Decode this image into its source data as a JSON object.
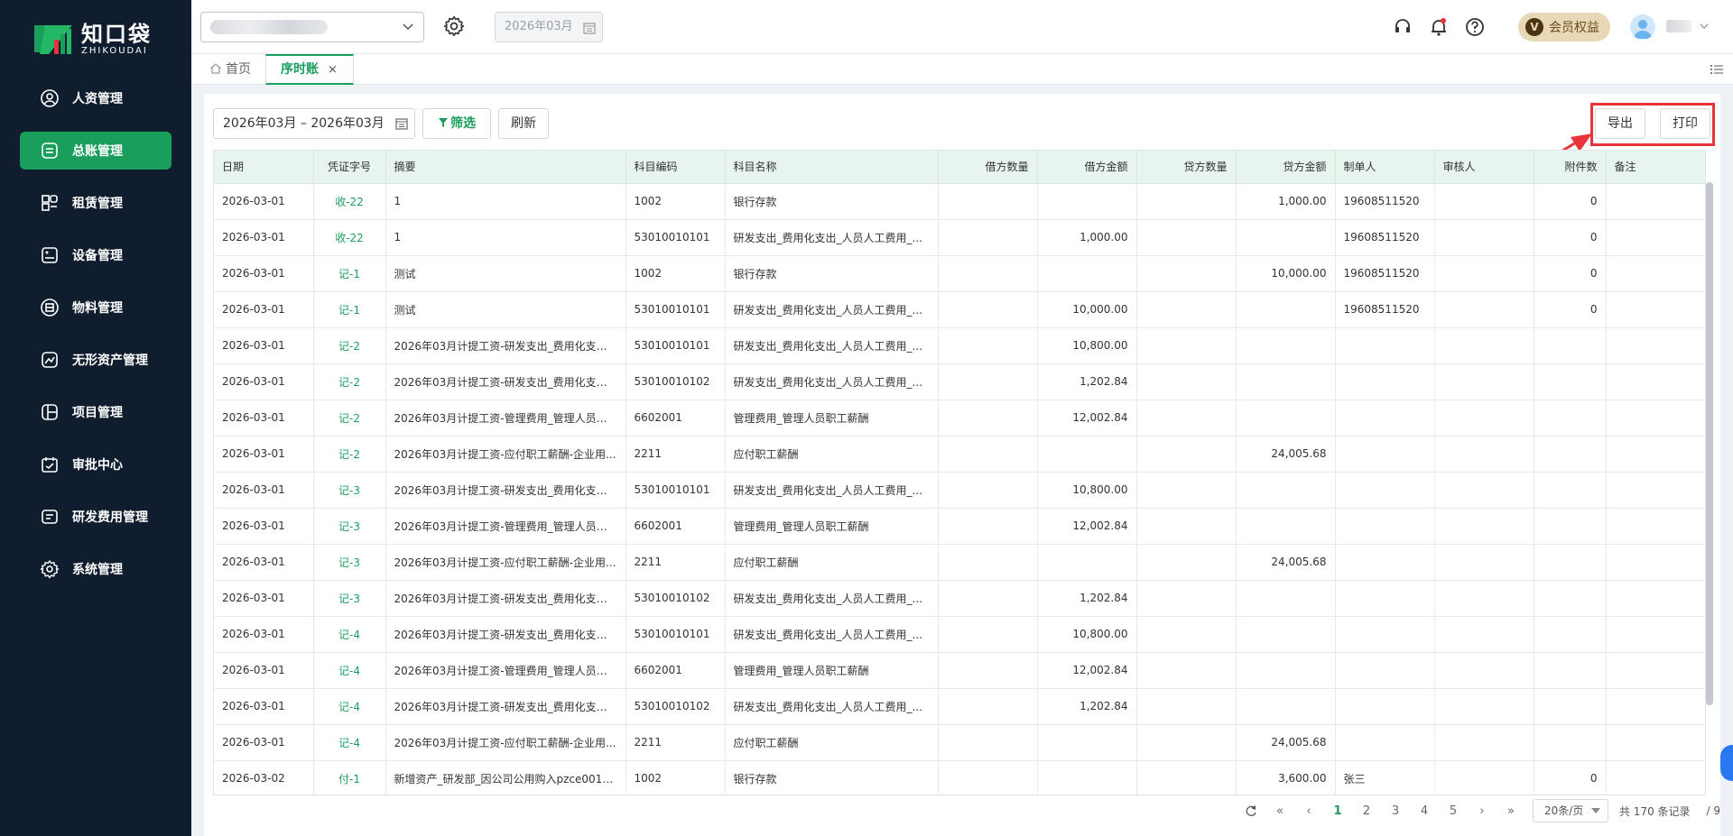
{
  "brand": {
    "name_cn": "知口袋",
    "name_en": "ZHIKOUDAI",
    "accent": "#1a9e5c"
  },
  "sidebar": {
    "items": [
      {
        "label": "人资管理",
        "icon": "user-icon",
        "active": false
      },
      {
        "label": "总账管理",
        "icon": "ledger-icon",
        "active": true
      },
      {
        "label": "租赁管理",
        "icon": "lease-icon",
        "active": false
      },
      {
        "label": "设备管理",
        "icon": "device-icon",
        "active": false
      },
      {
        "label": "物料管理",
        "icon": "box-icon",
        "active": false
      },
      {
        "label": "无形资产管理",
        "icon": "intangible-icon",
        "active": false
      },
      {
        "label": "项目管理",
        "icon": "project-icon",
        "active": false
      },
      {
        "label": "审批中心",
        "icon": "approval-icon",
        "active": false
      },
      {
        "label": "研发费用管理",
        "icon": "rd-icon",
        "active": false
      },
      {
        "label": "系统管理",
        "icon": "settings-icon",
        "active": false
      }
    ]
  },
  "header": {
    "period": "2026年03月",
    "vip_label": "会员权益",
    "vip_letter": "V"
  },
  "tabs": {
    "home": "首页",
    "active": "序时账",
    "close": "×"
  },
  "toolbar": {
    "date_range": "2026年03月 – 2026年03月",
    "filter": "筛选",
    "refresh": "刷新",
    "export": "导出",
    "print": "打印"
  },
  "table": {
    "columns": [
      "日期",
      "凭证字号",
      "摘要",
      "科目编码",
      "科目名称",
      "借方数量",
      "借方金额",
      "贷方数量",
      "贷方金额",
      "制单人",
      "审核人",
      "附件数",
      "备注"
    ],
    "rows": [
      [
        "2026-03-01",
        "收-22",
        "1",
        "1002",
        "银行存款",
        "",
        "",
        "",
        "1,000.00",
        "19608511520",
        "",
        "0",
        ""
      ],
      [
        "2026-03-01",
        "收-22",
        "1",
        "53010010101",
        "研发支出_费用化支出_人员人工费用_...",
        "",
        "1,000.00",
        "",
        "",
        "19608511520",
        "",
        "0",
        ""
      ],
      [
        "2026-03-01",
        "记-1",
        "测试",
        "1002",
        "银行存款",
        "",
        "",
        "",
        "10,000.00",
        "19608511520",
        "",
        "0",
        ""
      ],
      [
        "2026-03-01",
        "记-1",
        "测试",
        "53010010101",
        "研发支出_费用化支出_人员人工费用_...",
        "",
        "10,000.00",
        "",
        "",
        "19608511520",
        "",
        "0",
        ""
      ],
      [
        "2026-03-01",
        "记-2",
        "2026年03月计提工资-研发支出_费用化支出_...",
        "53010010101",
        "研发支出_费用化支出_人员人工费用_...",
        "",
        "10,800.00",
        "",
        "",
        "",
        "",
        "",
        ""
      ],
      [
        "2026-03-01",
        "记-2",
        "2026年03月计提工资-研发支出_费用化支出_...",
        "53010010102",
        "研发支出_费用化支出_人员人工费用_...",
        "",
        "1,202.84",
        "",
        "",
        "",
        "",
        "",
        ""
      ],
      [
        "2026-03-01",
        "记-2",
        "2026年03月计提工资-管理费用_管理人员职...",
        "6602001",
        "管理费用_管理人员职工薪酬",
        "",
        "12,002.84",
        "",
        "",
        "",
        "",
        "",
        ""
      ],
      [
        "2026-03-01",
        "记-2",
        "2026年03月计提工资-应付职工薪酬-企业用...",
        "2211",
        "应付职工薪酬",
        "",
        "",
        "",
        "24,005.68",
        "",
        "",
        "",
        ""
      ],
      [
        "2026-03-01",
        "记-3",
        "2026年03月计提工资-研发支出_费用化支出_...",
        "53010010101",
        "研发支出_费用化支出_人员人工费用_...",
        "",
        "10,800.00",
        "",
        "",
        "",
        "",
        "",
        ""
      ],
      [
        "2026-03-01",
        "记-3",
        "2026年03月计提工资-管理费用_管理人员职...",
        "6602001",
        "管理费用_管理人员职工薪酬",
        "",
        "12,002.84",
        "",
        "",
        "",
        "",
        "",
        ""
      ],
      [
        "2026-03-01",
        "记-3",
        "2026年03月计提工资-应付职工薪酬-企业用...",
        "2211",
        "应付职工薪酬",
        "",
        "",
        "",
        "24,005.68",
        "",
        "",
        "",
        ""
      ],
      [
        "2026-03-01",
        "记-3",
        "2026年03月计提工资-研发支出_费用化支出_...",
        "53010010102",
        "研发支出_费用化支出_人员人工费用_...",
        "",
        "1,202.84",
        "",
        "",
        "",
        "",
        "",
        ""
      ],
      [
        "2026-03-01",
        "记-4",
        "2026年03月计提工资-研发支出_费用化支出_...",
        "53010010101",
        "研发支出_费用化支出_人员人工费用_...",
        "",
        "10,800.00",
        "",
        "",
        "",
        "",
        "",
        ""
      ],
      [
        "2026-03-01",
        "记-4",
        "2026年03月计提工资-管理费用_管理人员职...",
        "6602001",
        "管理费用_管理人员职工薪酬",
        "",
        "12,002.84",
        "",
        "",
        "",
        "",
        "",
        ""
      ],
      [
        "2026-03-01",
        "记-4",
        "2026年03月计提工资-研发支出_费用化支出_...",
        "53010010102",
        "研发支出_费用化支出_人员人工费用_...",
        "",
        "1,202.84",
        "",
        "",
        "",
        "",
        "",
        ""
      ],
      [
        "2026-03-01",
        "记-4",
        "2026年03月计提工资-应付职工薪酬-企业用...",
        "2211",
        "应付职工薪酬",
        "",
        "",
        "",
        "24,005.68",
        "",
        "",
        "",
        ""
      ],
      [
        "2026-03-02",
        "付-1",
        "新增资产_研发部_因公司公用购入pzce001_...",
        "1002",
        "银行存款",
        "",
        "",
        "",
        "3,600.00",
        "张三",
        "",
        "0",
        ""
      ]
    ]
  },
  "pagination": {
    "pages": [
      "1",
      "2",
      "3",
      "4",
      "5"
    ],
    "current": "1",
    "page_size": "20条/页",
    "total": "共 170 条记录",
    "page_count": "/ 9"
  }
}
